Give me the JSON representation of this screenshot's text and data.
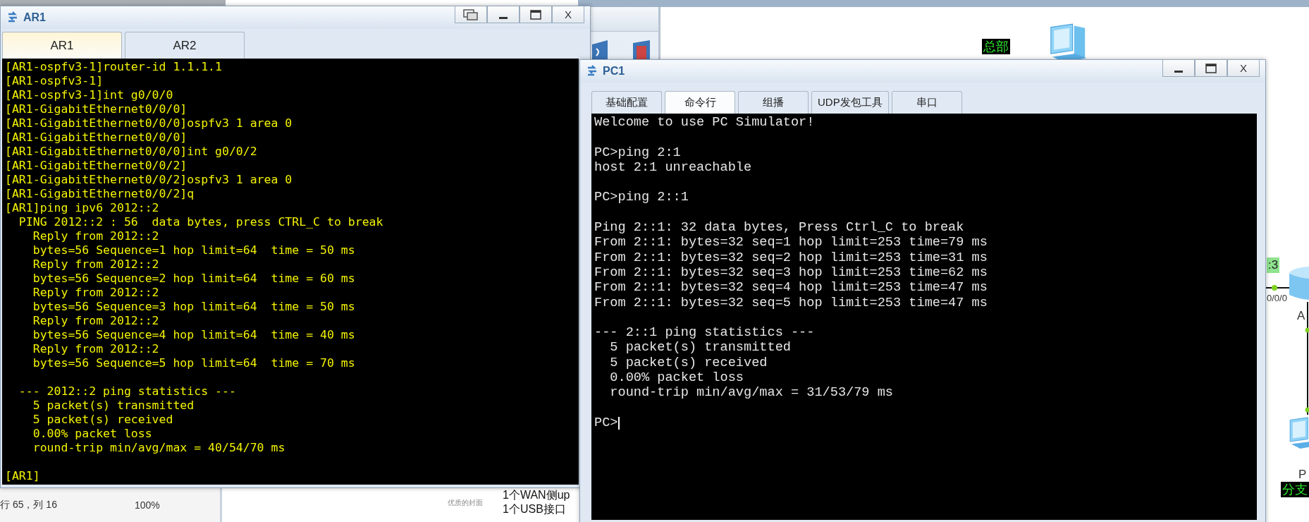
{
  "editor_status": {
    "position": "行 65，列 16",
    "zoom": "100%"
  },
  "side_notes": [
    {
      "kind": "caption",
      "text": "优质的封面"
    },
    {
      "kind": "line",
      "text": "1个WAN侧up"
    },
    {
      "kind": "line",
      "text": "1个USB接口"
    }
  ],
  "topology": {
    "hq_label": "总部",
    "link_label": ":3",
    "port_label": "0/0/0",
    "router_label": "A",
    "pc_label": "P",
    "branch_label": "分支"
  },
  "ar1_window": {
    "title": "AR1",
    "window_buttons": [
      {
        "kind": "restore"
      },
      {
        "kind": "minimize"
      },
      {
        "kind": "maximize"
      },
      {
        "kind": "close",
        "label": "X"
      }
    ],
    "tabs": [
      {
        "label": "AR1",
        "selected": true
      },
      {
        "label": "AR2",
        "selected": false
      }
    ],
    "terminal_blocks": [
      [
        "[AR1-ospfv3-1]router-id 1.1.1.1",
        "[AR1-ospfv3-1]",
        "[AR1-ospfv3-1]int g0/0/0",
        "[AR1-GigabitEthernet0/0/0]",
        "[AR1-GigabitEthernet0/0/0]ospfv3 1 area 0",
        "[AR1-GigabitEthernet0/0/0]",
        "[AR1-GigabitEthernet0/0/0]int g0/0/2",
        "[AR1-GigabitEthernet0/0/2]",
        "[AR1-GigabitEthernet0/0/2]ospfv3 1 area 0",
        "[AR1-GigabitEthernet0/0/2]q",
        "[AR1]ping ipv6 2012::2",
        "  PING 2012::2 : 56  data bytes, press CTRL_C to break",
        "    Reply from 2012::2",
        "    bytes=56 Sequence=1 hop limit=64  time = 50 ms",
        "    Reply from 2012::2",
        "    bytes=56 Sequence=2 hop limit=64  time = 60 ms",
        "    Reply from 2012::2",
        "    bytes=56 Sequence=3 hop limit=64  time = 50 ms",
        "    Reply from 2012::2",
        "    bytes=56 Sequence=4 hop limit=64  time = 40 ms",
        "    Reply from 2012::2",
        "    bytes=56 Sequence=5 hop limit=64  time = 70 ms"
      ],
      [
        "  --- 2012::2 ping statistics ---",
        "    5 packet(s) transmitted",
        "    5 packet(s) received",
        "    0.00% packet loss",
        "    round-trip min/avg/max = 40/54/70 ms"
      ],
      [
        "[AR1]"
      ]
    ]
  },
  "pc1_window": {
    "title": "PC1",
    "window_buttons": [
      {
        "kind": "minimize"
      },
      {
        "kind": "maximize"
      },
      {
        "kind": "close",
        "label": "X"
      }
    ],
    "tabs": [
      {
        "label": "基础配置",
        "selected": false
      },
      {
        "label": "命令行",
        "selected": true
      },
      {
        "label": "组播",
        "selected": false
      },
      {
        "label": "UDP发包工具",
        "selected": false
      },
      {
        "label": "串口",
        "selected": false
      }
    ],
    "terminal_blocks": [
      [
        "Welcome to use PC Simulator!"
      ],
      [
        "PC>ping 2:1",
        "host 2:1 unreachable"
      ],
      [
        "PC>ping 2::1"
      ],
      [
        "Ping 2::1: 32 data bytes, Press Ctrl_C to break",
        "From 2::1: bytes=32 seq=1 hop limit=253 time=79 ms",
        "From 2::1: bytes=32 seq=2 hop limit=253 time=31 ms",
        "From 2::1: bytes=32 seq=3 hop limit=253 time=62 ms",
        "From 2::1: bytes=32 seq=4 hop limit=253 time=47 ms",
        "From 2::1: bytes=32 seq=5 hop limit=253 time=47 ms"
      ],
      [
        "--- 2::1 ping statistics ---",
        "  5 packet(s) transmitted",
        "  5 packet(s) received",
        "  0.00% packet loss",
        "  round-trip min/avg/max = 31/53/79 ms"
      ],
      [
        "PC>"
      ]
    ],
    "cursor_visible": true
  }
}
